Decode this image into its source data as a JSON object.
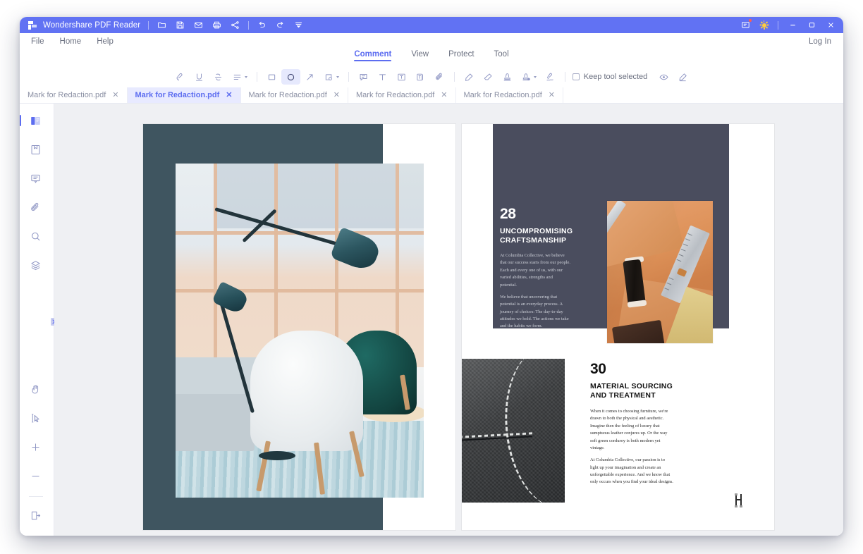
{
  "window": {
    "app_title": "Wondershare PDF Reader",
    "quick_actions": [
      {
        "name": "open-folder",
        "icon": "folder-icon"
      },
      {
        "name": "save",
        "icon": "save-icon"
      },
      {
        "name": "email",
        "icon": "envelope-icon"
      },
      {
        "name": "print",
        "icon": "printer-icon"
      },
      {
        "name": "share",
        "icon": "share-icon"
      }
    ],
    "history_actions": [
      {
        "name": "undo",
        "icon": "undo-icon"
      },
      {
        "name": "redo",
        "icon": "redo-icon"
      },
      {
        "name": "more-tools",
        "icon": "chevron-down-bar-icon"
      }
    ],
    "right_actions": [
      {
        "name": "notifications",
        "icon": "notification-icon",
        "badge": true
      },
      {
        "name": "theme",
        "icon": "sun-icon"
      }
    ],
    "controls": [
      {
        "name": "minimize",
        "icon": "minimize-icon",
        "glyph": "—"
      },
      {
        "name": "maximize",
        "icon": "maximize-icon",
        "glyph": "□"
      },
      {
        "name": "close",
        "icon": "close-icon",
        "glyph": "✕"
      }
    ]
  },
  "menubar": {
    "items": [
      {
        "label": "File"
      },
      {
        "label": "Home"
      },
      {
        "label": "Help"
      }
    ],
    "login_label": "Log In"
  },
  "ribbon": {
    "tabs": [
      {
        "label": "Comment",
        "active": true
      },
      {
        "label": "View",
        "active": false
      },
      {
        "label": "Protect",
        "active": false
      },
      {
        "label": "Tool",
        "active": false
      }
    ]
  },
  "toolbar": {
    "tools": [
      {
        "name": "highlight-tool",
        "icon": "highlighter-icon",
        "selected": false
      },
      {
        "name": "underline-tool",
        "icon": "underline-icon",
        "selected": false
      },
      {
        "name": "strikethrough-tool",
        "icon": "strikethrough-icon",
        "selected": false
      },
      {
        "name": "text-markup-more",
        "icon": "lines-icon",
        "selected": false,
        "dropdown": true
      },
      {
        "name": "rectangle-tool",
        "icon": "rectangle-icon",
        "selected": false
      },
      {
        "name": "ellipse-tool",
        "icon": "ellipse-icon",
        "selected": true
      },
      {
        "name": "arrow-tool",
        "icon": "arrow-icon",
        "selected": false
      },
      {
        "name": "shapes-more",
        "icon": "shapes-icon",
        "selected": false,
        "dropdown": true
      },
      {
        "name": "sticky-note-tool",
        "icon": "note-icon",
        "selected": false
      },
      {
        "name": "typewriter-tool",
        "icon": "text-icon",
        "selected": false
      },
      {
        "name": "text-box-tool",
        "icon": "textbox-icon",
        "selected": false
      },
      {
        "name": "callout-tool",
        "icon": "callout-icon",
        "selected": false
      },
      {
        "name": "attachment-tool",
        "icon": "paperclip-icon",
        "selected": false
      },
      {
        "name": "pencil-tool",
        "icon": "pencil-icon",
        "selected": false
      },
      {
        "name": "eraser-tool",
        "icon": "eraser-icon",
        "selected": false
      },
      {
        "name": "stamp-tool",
        "icon": "stamp-icon",
        "selected": false
      },
      {
        "name": "custom-stamp-tool",
        "icon": "stamp-plus-icon",
        "selected": false,
        "dropdown": true
      },
      {
        "name": "signature-tool",
        "icon": "signature-icon",
        "selected": false
      }
    ],
    "keep_tool_label": "Keep tool selected",
    "keep_tool_checked": false,
    "right_tools": [
      {
        "name": "show-comments",
        "icon": "eye-icon"
      },
      {
        "name": "edit-markup",
        "icon": "pen-icon"
      }
    ]
  },
  "doc_tabs": [
    {
      "label": "Mark for Redaction.pdf",
      "active": false,
      "close": "✕"
    },
    {
      "label": "Mark for Redaction.pdf",
      "active": true,
      "close": "✕"
    },
    {
      "label": "Mark for Redaction.pdf",
      "active": false,
      "close": "✕"
    },
    {
      "label": "Mark for Redaction.pdf",
      "active": false,
      "close": "✕"
    },
    {
      "label": "Mark for Redaction.pdf",
      "active": false,
      "close": "✕"
    }
  ],
  "sidebar": {
    "top_items": [
      {
        "name": "thumbnails-panel",
        "icon": "thumbnails-icon",
        "active": true
      },
      {
        "name": "bookmarks-panel",
        "icon": "bookmark-icon",
        "active": false
      },
      {
        "name": "comments-panel",
        "icon": "comment-icon",
        "active": false
      },
      {
        "name": "attachments-panel",
        "icon": "paperclip-icon",
        "active": false
      },
      {
        "name": "search-panel",
        "icon": "search-icon",
        "active": false
      },
      {
        "name": "layers-panel",
        "icon": "layers-icon",
        "active": false
      }
    ],
    "bottom_items": [
      {
        "name": "hand-tool",
        "icon": "hand-icon"
      },
      {
        "name": "select-tool",
        "icon": "cursor-select-icon"
      },
      {
        "name": "zoom-in",
        "icon": "plus-icon"
      },
      {
        "name": "zoom-out",
        "icon": "minus-icon"
      },
      {
        "name": "page-fit",
        "icon": "page-export-icon"
      }
    ],
    "expander": {
      "name": "panel-expander",
      "icon": "chevron-right-icon"
    }
  },
  "document": {
    "left_page": {
      "photo_alt": "Interior with lamp and chairs"
    },
    "right_page": {
      "section_one": {
        "number": "28",
        "heading": "UNCOMPROMISING\nCRAFTSMANSHIP",
        "heading_line1": "UNCOMPROMISING",
        "heading_line2": "CRAFTSMANSHIP",
        "paragraph_1": "At Columbia Collective, we believe that our success starts from our people. Each and every one of us, with our varied abilities, strengths and potential.",
        "paragraph_2": "We believe that uncovering that potential is an everyday process. A journey of choices: The day-to-day attitudes we hold. The actions we take and the habits we form."
      },
      "section_two": {
        "number": "30",
        "heading_line1": "MATERIAL SOURCING",
        "heading_line2": "AND TREATMENT",
        "paragraph_1": "When it comes to choosing furniture, we're drawn to both the physical and aesthetic. Imagine then the feeling of luxury that sumptuous leather conjures up. Or the way soft green corduroy is both modern yet vintage.",
        "paragraph_2": "At Columbia Collective, our passion is to light up your imagination and create an unforgettable experience. And we know that only occurs when you find your ideal designs."
      }
    }
  },
  "colors": {
    "titlebar": "#6172f3",
    "accent": "#5d6df0",
    "tab_active_bg": "#e8eaff",
    "viewer_bg": "#eff0f3",
    "slab_left": "#3f5560",
    "slab_right": "#4a4d5e"
  }
}
